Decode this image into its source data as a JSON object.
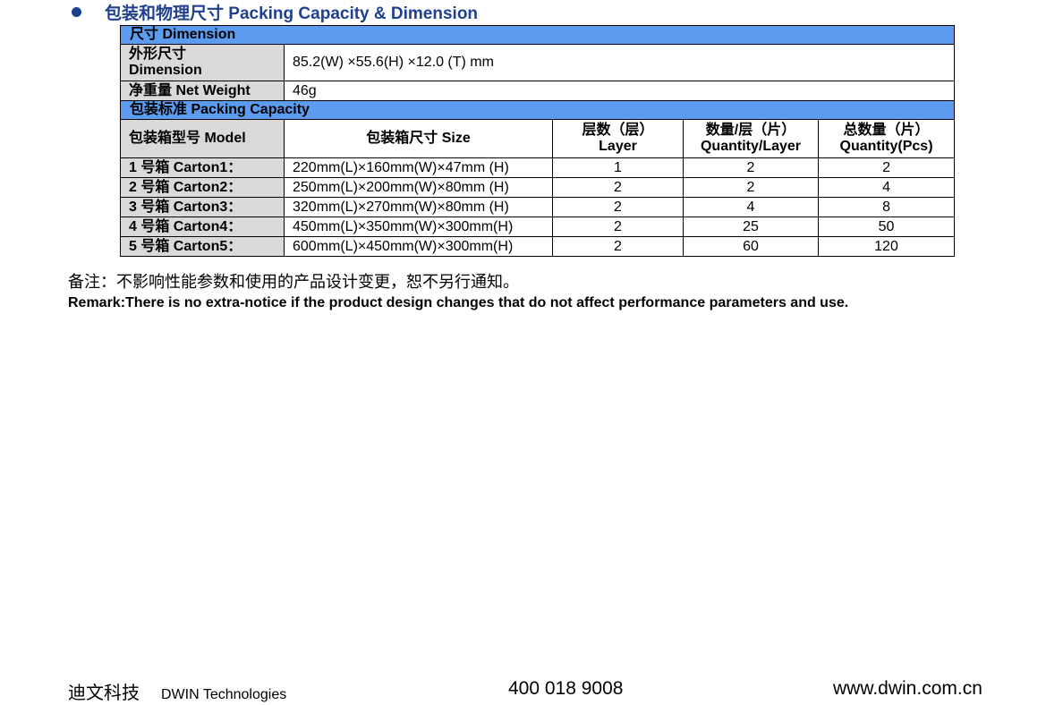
{
  "heading": "包装和物理尺寸 Packing Capacity & Dimension",
  "dimension_section": {
    "title": "尺寸 Dimension",
    "outline": {
      "label_cn": "外形尺寸",
      "label_en": "Dimension",
      "value": "85.2(W) ×55.6(H) ×12.0 (T) mm"
    },
    "weight": {
      "label": "净重量 Net Weight",
      "value": "46g"
    }
  },
  "packing_section": {
    "title": "包装标准 Packing Capacity",
    "headers": {
      "model": "包装箱型号 Model",
      "size": "包装箱尺寸 Size",
      "layer_cn": "层数（层）",
      "layer_en": "Layer",
      "qty_layer_cn": "数量/层（片）",
      "qty_layer_en": "Quantity/Layer",
      "total_cn": "总数量（片）",
      "total_en": "Quantity(Pcs)"
    },
    "rows": [
      {
        "model": "1 号箱 Carton1：",
        "size": "220mm(L)×160mm(W)×47mm (H)",
        "layer": "1",
        "qty_layer": "2",
        "total": "2"
      },
      {
        "model": "2 号箱 Carton2：",
        "size": "250mm(L)×200mm(W)×80mm (H)",
        "layer": "2",
        "qty_layer": "2",
        "total": "4"
      },
      {
        "model": "3 号箱 Carton3：",
        "size": "320mm(L)×270mm(W)×80mm (H)",
        "layer": "2",
        "qty_layer": "4",
        "total": "8"
      },
      {
        "model": "4 号箱 Carton4：",
        "size": "450mm(L)×350mm(W)×300mm(H)",
        "layer": "2",
        "qty_layer": "25",
        "total": "50"
      },
      {
        "model": "5 号箱 Carton5：",
        "size": "600mm(L)×450mm(W)×300mm(H)",
        "layer": "2",
        "qty_layer": "60",
        "total": "120"
      }
    ]
  },
  "remark_cn": "备注：不影响性能参数和使用的产品设计变更，恕不另行通知。",
  "remark_en": "Remark:There is no extra-notice if the product design changes that do not affect performance parameters and use.",
  "footer": {
    "company_cn": "迪文科技",
    "company_en": "DWIN Technologies",
    "phone": "400 018 9008",
    "website": "www.dwin.com.cn"
  }
}
